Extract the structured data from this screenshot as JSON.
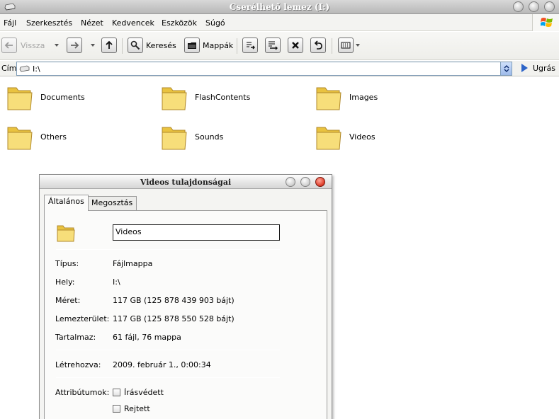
{
  "window": {
    "title": "Cserélhető lemez (I:)"
  },
  "menu": [
    "Fájl",
    "Szerkesztés",
    "Nézet",
    "Kedvencek",
    "Eszközök",
    "Súgó"
  ],
  "toolbar": {
    "back": "Vissza",
    "search": "Keresés",
    "folders": "Mappák"
  },
  "address": {
    "label": "Cím",
    "value": "I:\\",
    "go": "Ugrás"
  },
  "folders": [
    "Documents",
    "FlashContents",
    "Images",
    "Others",
    "Sounds",
    "Videos"
  ],
  "dialog": {
    "title": "Videos tulajdonságai",
    "tabs": [
      "Általános",
      "Megosztás"
    ],
    "name": "Videos",
    "rows": [
      {
        "label": "Típus:",
        "value": "Fájlmappa"
      },
      {
        "label": "Hely:",
        "value": "I:\\"
      },
      {
        "label": "Méret:",
        "value": "117 GB (125 878 439 903 bájt)"
      },
      {
        "label": "Lemezterület:",
        "value": "117 GB (125 878 550 528 bájt)"
      },
      {
        "label": "Tartalmaz:",
        "value": "61 fájl, 76 mappa"
      }
    ],
    "created": {
      "label": "Létrehozva:",
      "value": "2009. február 1., 0:00:34"
    },
    "attributes": {
      "label": "Attribútumok:",
      "readonly": "Írásvédett",
      "hidden": "Rejtett"
    }
  },
  "colors": {
    "folder": "#f2d25a",
    "accent": "#316ac5",
    "close": "#e0402d"
  }
}
